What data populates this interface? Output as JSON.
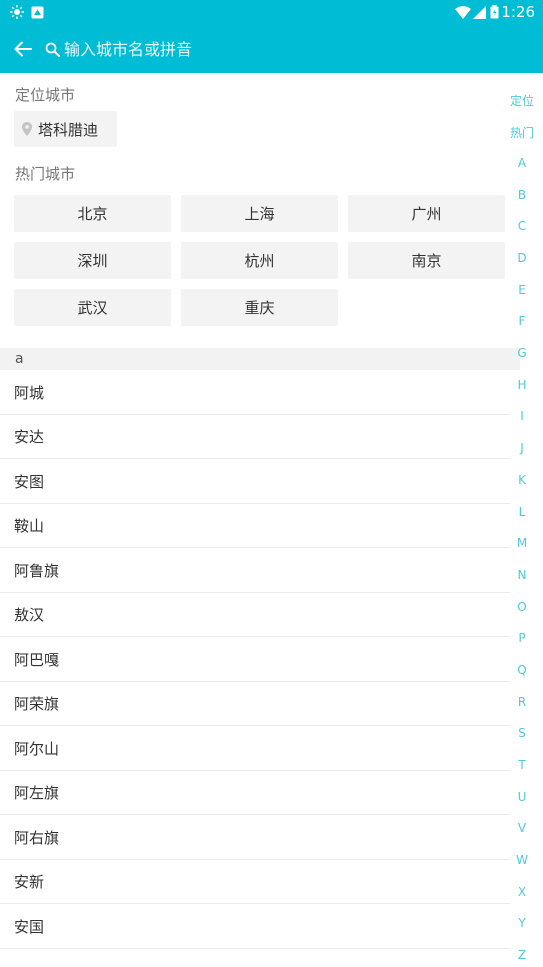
{
  "status_bar": {
    "time": "1:26"
  },
  "toolbar": {
    "search_placeholder": "输入城市名或拼音"
  },
  "location": {
    "title": "定位城市",
    "city": "塔科腊迪"
  },
  "hot": {
    "title": "热门城市",
    "cities": [
      "北京",
      "上海",
      "广州",
      "深圳",
      "杭州",
      "南京",
      "武汉",
      "重庆"
    ]
  },
  "group": {
    "letter": "a",
    "cities": [
      "阿城",
      "安达",
      "安图",
      "鞍山",
      "阿鲁旗",
      "敖汉",
      "阿巴嘎",
      "阿荣旗",
      "阿尔山",
      "阿左旗",
      "阿右旗",
      "安新",
      "安国"
    ]
  },
  "index_bar": [
    "定位",
    "热门",
    "A",
    "B",
    "C",
    "D",
    "E",
    "F",
    "G",
    "H",
    "I",
    "J",
    "K",
    "L",
    "M",
    "N",
    "O",
    "P",
    "Q",
    "R",
    "S",
    "T",
    "U",
    "V",
    "W",
    "X",
    "Y",
    "Z"
  ],
  "colors": {
    "accent": "#00bcd4",
    "index_text": "#4fc8dc",
    "chip_bg": "#f3f3f3"
  }
}
